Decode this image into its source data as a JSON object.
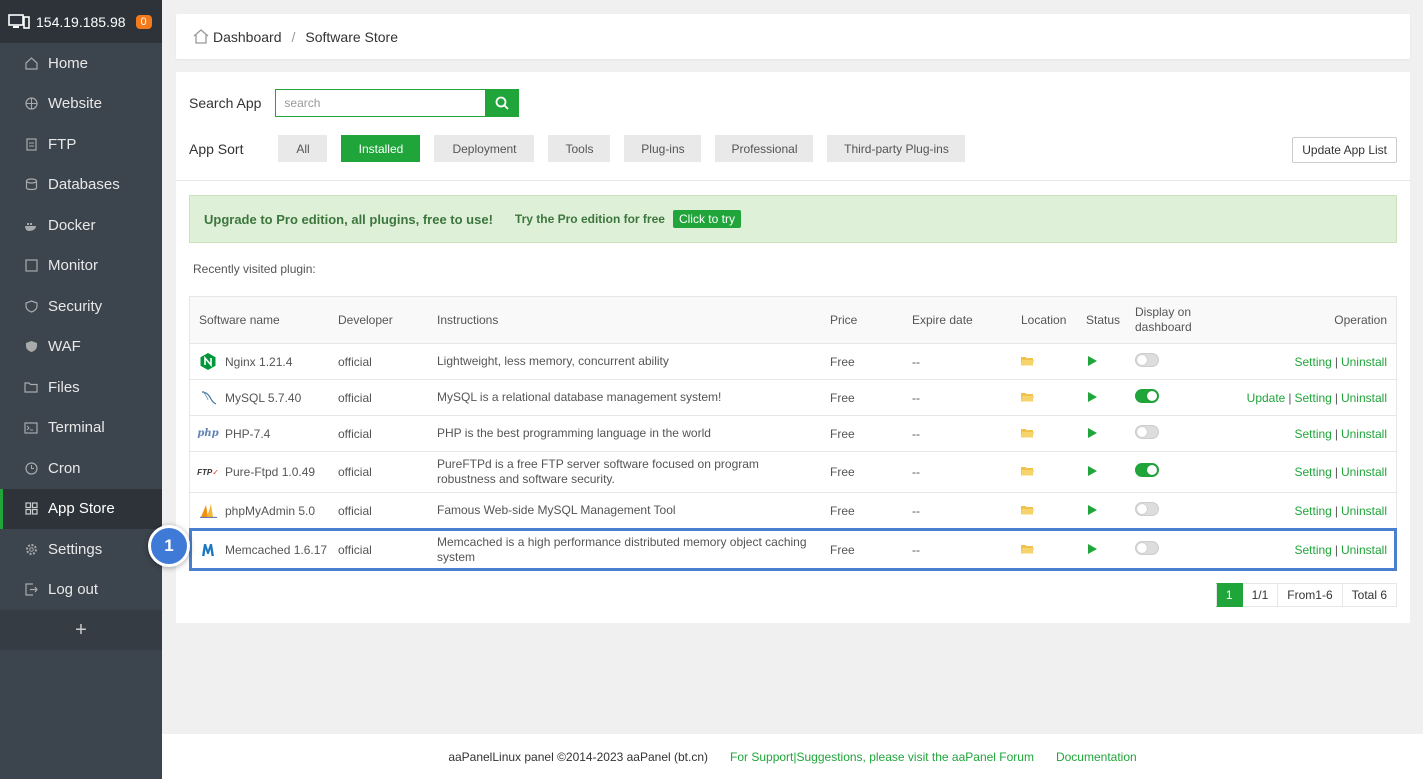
{
  "sidebar": {
    "server_ip": "154.19.185.98",
    "badge_count": "0",
    "items": [
      {
        "label": "Home",
        "icon": "home-icon"
      },
      {
        "label": "Website",
        "icon": "globe-icon"
      },
      {
        "label": "FTP",
        "icon": "ftp-icon"
      },
      {
        "label": "Databases",
        "icon": "database-icon"
      },
      {
        "label": "Docker",
        "icon": "docker-icon"
      },
      {
        "label": "Monitor",
        "icon": "monitor-icon"
      },
      {
        "label": "Security",
        "icon": "shield-icon"
      },
      {
        "label": "WAF",
        "icon": "waf-shield-icon"
      },
      {
        "label": "Files",
        "icon": "folder-icon"
      },
      {
        "label": "Terminal",
        "icon": "terminal-icon"
      },
      {
        "label": "Cron",
        "icon": "clock-icon"
      },
      {
        "label": "App Store",
        "icon": "grid-icon"
      },
      {
        "label": "Settings",
        "icon": "gear-icon"
      },
      {
        "label": "Log out",
        "icon": "logout-icon"
      }
    ],
    "add_label": "+"
  },
  "breadcrumb": {
    "home": "Dashboard",
    "separator": "/",
    "current": "Software Store"
  },
  "search": {
    "label": "Search App",
    "placeholder": "search"
  },
  "sort": {
    "label": "App Sort",
    "options": [
      "All",
      "Installed",
      "Deployment",
      "Tools",
      "Plug-ins",
      "Professional",
      "Third-party Plug-ins"
    ],
    "active": "Installed"
  },
  "update_button": "Update App List",
  "promo": {
    "title": "Upgrade to Pro edition, all plugins, free to use!",
    "sub": "Try the Pro edition for free",
    "cta": "Click to try"
  },
  "recent_label": "Recently visited plugin:",
  "table": {
    "headers": {
      "name": "Software name",
      "developer": "Developer",
      "instructions": "Instructions",
      "price": "Price",
      "expire": "Expire date",
      "location": "Location",
      "status": "Status",
      "display": "Display on dashboard",
      "operation": "Operation"
    },
    "rows": [
      {
        "name": "Nginx 1.21.4",
        "developer": "official",
        "instructions": "Lightweight, less memory, concurrent ability",
        "price": "Free",
        "expire": "--",
        "display_on": false,
        "ops": [
          "Setting",
          "Uninstall"
        ]
      },
      {
        "name": "MySQL 5.7.40",
        "developer": "official",
        "instructions": "MySQL is a relational database management system!",
        "price": "Free",
        "expire": "--",
        "display_on": true,
        "ops": [
          "Update",
          "Setting",
          "Uninstall"
        ]
      },
      {
        "name": "PHP-7.4",
        "developer": "official",
        "instructions": "PHP is the best programming language in the world",
        "price": "Free",
        "expire": "--",
        "display_on": false,
        "ops": [
          "Setting",
          "Uninstall"
        ]
      },
      {
        "name": "Pure-Ftpd 1.0.49",
        "developer": "official",
        "instructions": "PureFTPd is a free FTP server software focused on program robustness and software security.",
        "price": "Free",
        "expire": "--",
        "display_on": true,
        "ops": [
          "Setting",
          "Uninstall"
        ]
      },
      {
        "name": "phpMyAdmin 5.0",
        "developer": "official",
        "instructions": "Famous Web-side MySQL Management Tool",
        "price": "Free",
        "expire": "--",
        "display_on": false,
        "ops": [
          "Setting",
          "Uninstall"
        ]
      },
      {
        "name": "Memcached 1.6.17",
        "developer": "official",
        "instructions": "Memcached is a high performance distributed memory object caching system",
        "price": "Free",
        "expire": "--",
        "display_on": false,
        "ops": [
          "Setting",
          "Uninstall"
        ]
      }
    ],
    "op_separator": "|"
  },
  "step_marker": "1",
  "pager": {
    "current": "1",
    "pages": "1/1",
    "range": "From1-6",
    "total": "Total 6"
  },
  "footer": {
    "copyright": "aaPanelLinux panel ©2014-2023 aaPanel (bt.cn)",
    "support": "For Support|Suggestions, please visit the aaPanel Forum",
    "docs": "Documentation"
  },
  "colors": {
    "accent": "#20a53a",
    "sidebar": "#3c444d",
    "highlight": "#4a7fd0"
  }
}
